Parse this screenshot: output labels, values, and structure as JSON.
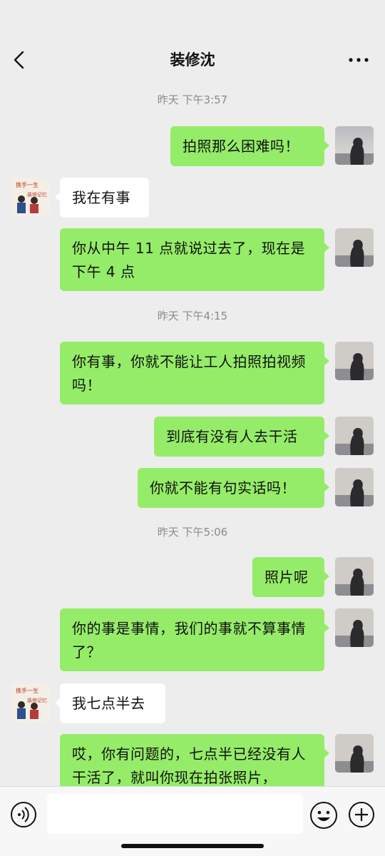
{
  "header": {
    "title": "装修沈",
    "back_icon": "chevron-left-icon",
    "more_icon": "more-horizontal-icon"
  },
  "messages": [
    {
      "type": "time",
      "text": "昨天 下午3:57"
    },
    {
      "type": "me",
      "text": "拍照那么困难吗！"
    },
    {
      "type": "other",
      "text": "我在有事"
    },
    {
      "type": "me",
      "text": "你从中午 11 点就说过去了，现在是下午 4 点"
    },
    {
      "type": "time",
      "text": "昨天 下午4:15"
    },
    {
      "type": "me",
      "text": "你有事，你就不能让工人拍照拍视频吗！"
    },
    {
      "type": "me",
      "text": "到底有没有人去干活"
    },
    {
      "type": "me",
      "text": "你就不能有句实话吗！"
    },
    {
      "type": "time",
      "text": "昨天 下午5:06"
    },
    {
      "type": "me",
      "text": "照片呢"
    },
    {
      "type": "me",
      "text": "你的事是事情，我们的事就不算事情了？"
    },
    {
      "type": "other",
      "text": "我七点半去"
    },
    {
      "type": "me",
      "text": "哎，你有问题的，七点半已经没有人干活了，就叫你现在拍张照片，"
    }
  ],
  "other_avatar": {
    "banner_text": "携手一生 装修记忆"
  },
  "input_bar": {
    "voice_icon": "voice-icon",
    "emoji_icon": "emoji-icon",
    "plus_icon": "plus-icon",
    "placeholder": ""
  },
  "colors": {
    "me_bubble": "#95ec69",
    "other_bubble": "#ffffff",
    "background": "#ededed"
  }
}
